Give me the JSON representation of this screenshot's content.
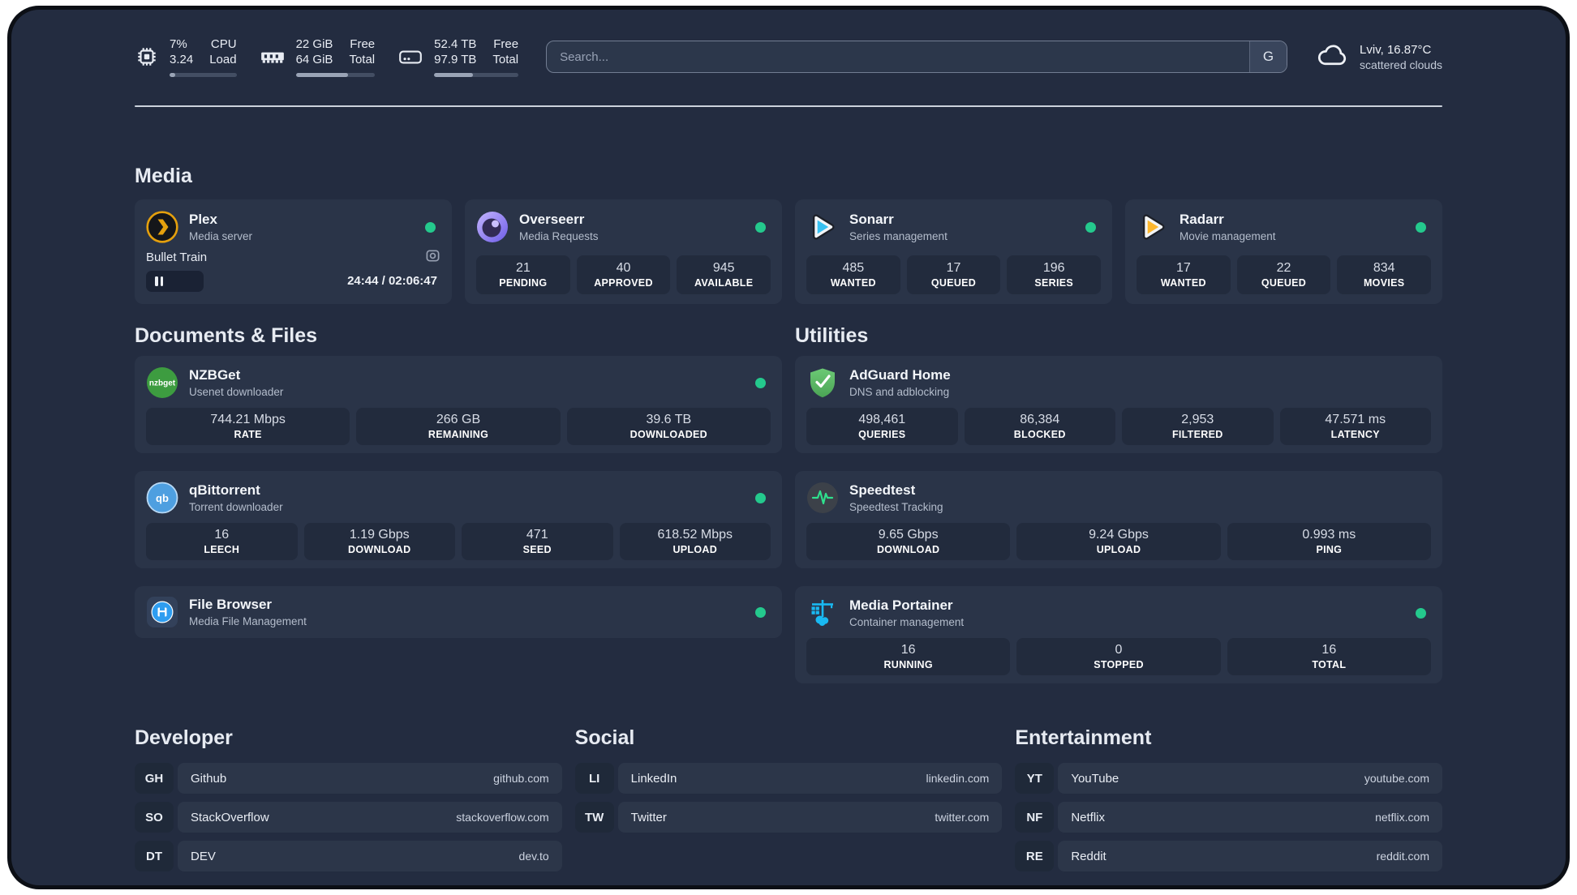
{
  "header": {
    "stats": [
      {
        "icon": "cpu-icon",
        "values": [
          "7%",
          "3.24"
        ],
        "labels": [
          "CPU",
          "Load"
        ],
        "progress_pct": 8
      },
      {
        "icon": "ram-icon",
        "values": [
          "22 GiB",
          "64 GiB"
        ],
        "labels": [
          "Free",
          "Total"
        ],
        "progress_pct": 66
      },
      {
        "icon": "disk-icon",
        "values": [
          "52.4 TB",
          "97.9 TB"
        ],
        "labels": [
          "Free",
          "Total"
        ],
        "progress_pct": 46
      }
    ],
    "search": {
      "placeholder": "Search...",
      "engine": "G"
    },
    "weather": {
      "title": "Lviv, 16.87°C",
      "subtitle": "scattered clouds"
    }
  },
  "media": {
    "title": "Media",
    "plex": {
      "name": "Plex",
      "desc": "Media server",
      "status": "online",
      "player": {
        "title": "Bullet Train",
        "time": "24:44 / 02:06:47",
        "progress_pct": 19.5
      }
    },
    "overseerr": {
      "name": "Overseerr",
      "desc": "Media Requests",
      "status": "online",
      "stats": [
        {
          "value": "21",
          "label": "PENDING"
        },
        {
          "value": "40",
          "label": "APPROVED"
        },
        {
          "value": "945",
          "label": "AVAILABLE"
        }
      ]
    },
    "sonarr": {
      "name": "Sonarr",
      "desc": "Series management",
      "status": "online",
      "stats": [
        {
          "value": "485",
          "label": "WANTED"
        },
        {
          "value": "17",
          "label": "QUEUED"
        },
        {
          "value": "196",
          "label": "SERIES"
        }
      ]
    },
    "radarr": {
      "name": "Radarr",
      "desc": "Movie management",
      "status": "online",
      "stats": [
        {
          "value": "17",
          "label": "WANTED"
        },
        {
          "value": "22",
          "label": "QUEUED"
        },
        {
          "value": "834",
          "label": "MOVIES"
        }
      ]
    }
  },
  "documents": {
    "title": "Documents & Files",
    "nzbget": {
      "name": "NZBGet",
      "desc": "Usenet downloader",
      "status": "online",
      "stats": [
        {
          "value": "744.21 Mbps",
          "label": "RATE"
        },
        {
          "value": "266 GB",
          "label": "REMAINING"
        },
        {
          "value": "39.6 TB",
          "label": "DOWNLOADED"
        }
      ]
    },
    "qbittorrent": {
      "name": "qBittorrent",
      "desc": "Torrent downloader",
      "status": "online",
      "stats": [
        {
          "value": "16",
          "label": "LEECH"
        },
        {
          "value": "1.19 Gbps",
          "label": "DOWNLOAD"
        },
        {
          "value": "471",
          "label": "SEED"
        },
        {
          "value": "618.52 Mbps",
          "label": "UPLOAD"
        }
      ]
    },
    "filebrowser": {
      "name": "File Browser",
      "desc": "Media File Management",
      "status": "online"
    }
  },
  "utilities": {
    "title": "Utilities",
    "adguard": {
      "name": "AdGuard Home",
      "desc": "DNS and adblocking",
      "stats": [
        {
          "value": "498,461",
          "label": "QUERIES"
        },
        {
          "value": "86,384",
          "label": "BLOCKED"
        },
        {
          "value": "2,953",
          "label": "FILTERED"
        },
        {
          "value": "47.571 ms",
          "label": "LATENCY"
        }
      ]
    },
    "speedtest": {
      "name": "Speedtest",
      "desc": "Speedtest Tracking",
      "stats": [
        {
          "value": "9.65 Gbps",
          "label": "DOWNLOAD"
        },
        {
          "value": "9.24 Gbps",
          "label": "UPLOAD"
        },
        {
          "value": "0.993 ms",
          "label": "PING"
        }
      ]
    },
    "portainer": {
      "name": "Media Portainer",
      "desc": "Container management",
      "status": "online",
      "stats": [
        {
          "value": "16",
          "label": "RUNNING"
        },
        {
          "value": "0",
          "label": "STOPPED"
        },
        {
          "value": "16",
          "label": "TOTAL"
        }
      ]
    }
  },
  "bookmarks": [
    {
      "title": "Developer",
      "items": [
        {
          "abbr": "GH",
          "name": "Github",
          "url": "github.com"
        },
        {
          "abbr": "SO",
          "name": "StackOverflow",
          "url": "stackoverflow.com"
        },
        {
          "abbr": "DT",
          "name": "DEV",
          "url": "dev.to"
        }
      ]
    },
    {
      "title": "Social",
      "items": [
        {
          "abbr": "LI",
          "name": "LinkedIn",
          "url": "linkedin.com"
        },
        {
          "abbr": "TW",
          "name": "Twitter",
          "url": "twitter.com"
        }
      ]
    },
    {
      "title": "Entertainment",
      "items": [
        {
          "abbr": "YT",
          "name": "YouTube",
          "url": "youtube.com"
        },
        {
          "abbr": "NF",
          "name": "Netflix",
          "url": "netflix.com"
        },
        {
          "abbr": "RE",
          "name": "Reddit",
          "url": "reddit.com"
        }
      ]
    }
  ],
  "colors": {
    "status_online": "#24c98d",
    "plex_accent": "#e5a00d",
    "portainer_accent": "#19b9f2"
  }
}
